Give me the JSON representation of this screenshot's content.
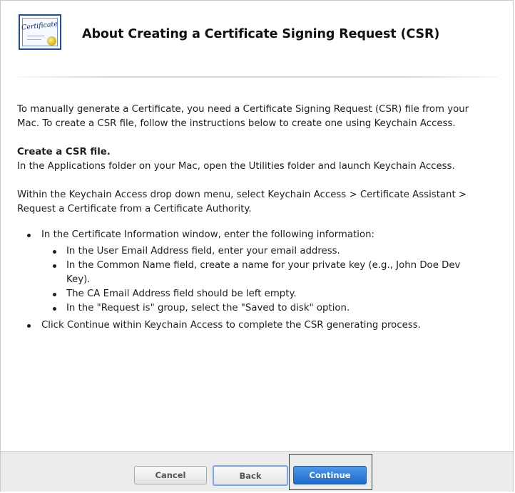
{
  "header": {
    "icon": "certificate-icon",
    "icon_text": "Certificate",
    "title": "About Creating a Certificate Signing Request (CSR)"
  },
  "content": {
    "intro": "To manually generate a Certificate, you need a Certificate Signing Request (CSR) file from your Mac. To create a CSR file, follow the instructions below to create one using Keychain Access.",
    "subheading": "Create a CSR file.",
    "step1": "In the Applications folder on your Mac, open the Utilities folder and launch Keychain Access.",
    "step2": "Within the Keychain Access drop down menu, select Keychain Access > Certificate Assistant > Request a Certificate from a Certificate Authority.",
    "bullets": [
      {
        "text": "In the Certificate Information window, enter the following information:",
        "sub": [
          "In the User Email Address field, enter your email address.",
          "In the Common Name field, create a name for your private key (e.g., John Doe Dev Key).",
          "The CA Email Address field should be left empty.",
          "In the \"Request is\" group, select the \"Saved to disk\" option."
        ]
      },
      {
        "text": "Click Continue within Keychain Access to complete the CSR generating process."
      }
    ]
  },
  "footer": {
    "cancel_label": "Cancel",
    "back_label": "Back",
    "continue_label": "Continue"
  },
  "colors": {
    "accent": "#1d69c9",
    "icon_border": "#1d4fa0",
    "seal": "#d6b21f"
  }
}
